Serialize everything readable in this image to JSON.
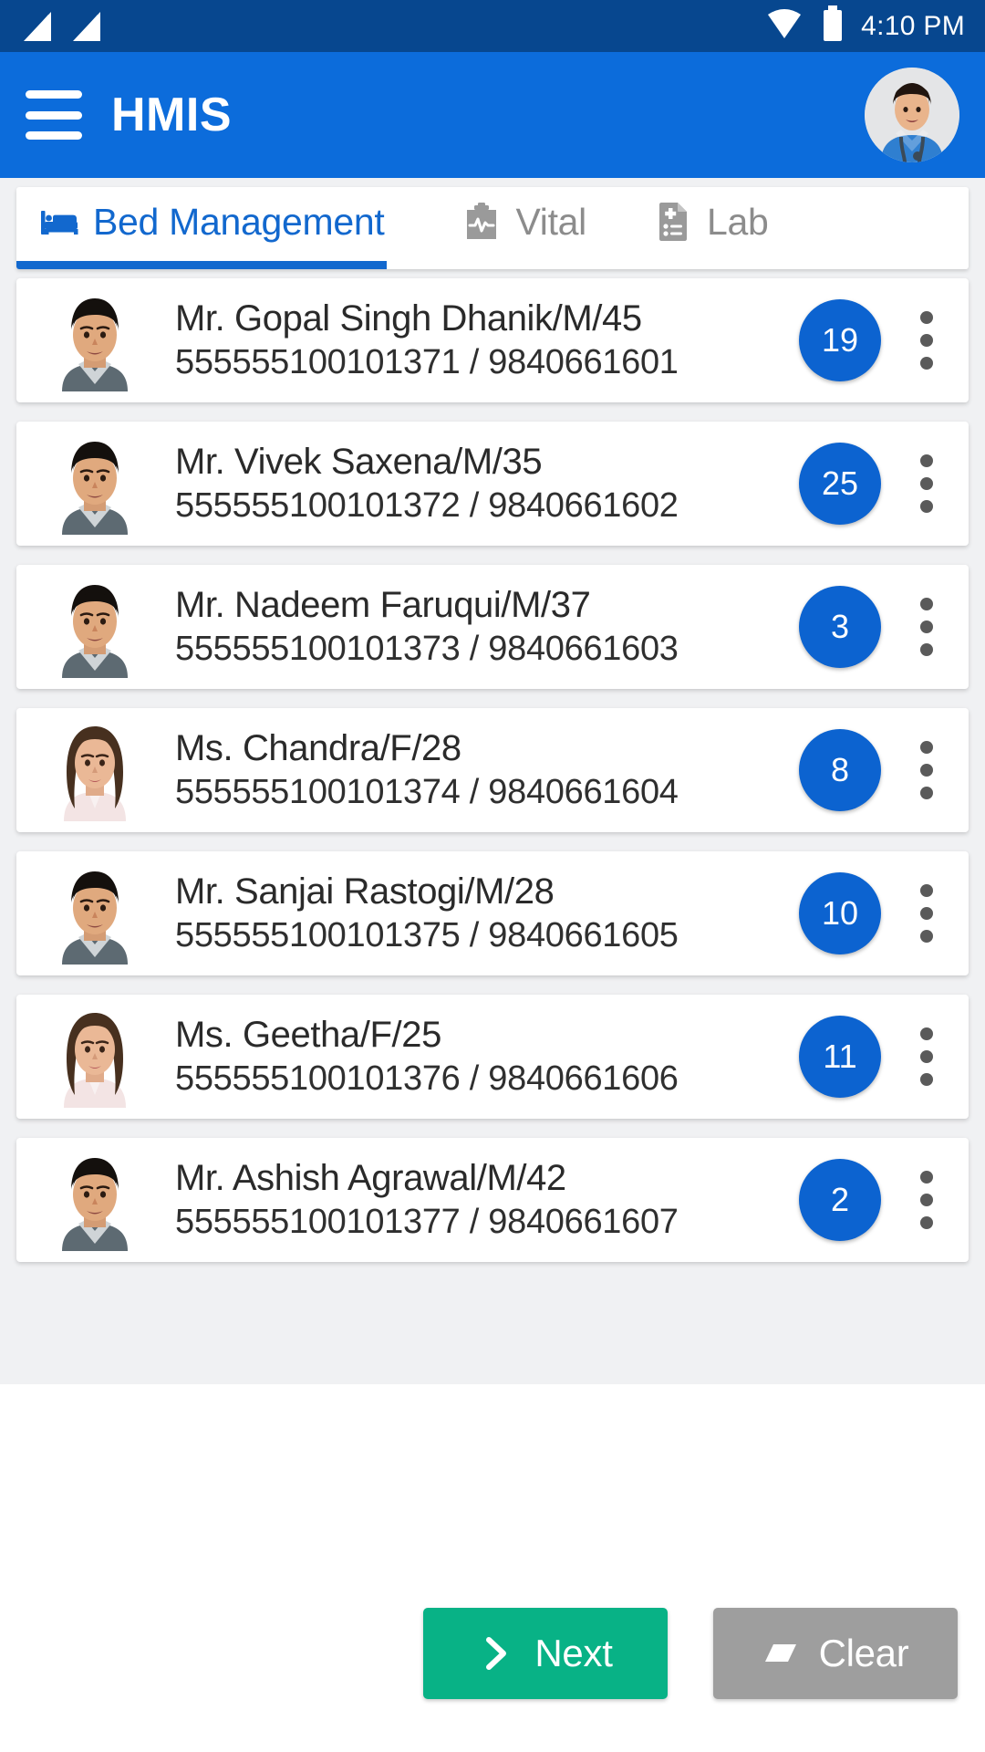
{
  "status_bar": {
    "time": "4:10 PM",
    "icons": [
      "signal-icon",
      "signal-icon",
      "wifi-icon",
      "battery-icon"
    ],
    "background_color": "#07478F"
  },
  "app_bar": {
    "menu_icon": "hamburger-menu-icon",
    "title": "HMIS",
    "avatar_icon": "user-avatar-nurse",
    "background_color": "#0C6CDB"
  },
  "tabs": [
    {
      "id": "bed-management",
      "label": "Bed Management",
      "icon": "bed-icon",
      "active": true
    },
    {
      "id": "vital",
      "label": "Vital",
      "icon": "clipboard-pulse-icon",
      "active": false
    },
    {
      "id": "lab",
      "label": "Lab",
      "icon": "lab-report-icon",
      "active": false
    }
  ],
  "tab_colors": {
    "active": "#1268CE",
    "inactive": "#8C8C8C",
    "underline": "#1268CE"
  },
  "patients": [
    {
      "name": "Mr. Gopal Singh Dhanik/M/45",
      "meta": "555555100101371 / 9840661601",
      "bed": "19",
      "avatar": "male",
      "menu_icon": "more-vertical-icon"
    },
    {
      "name": "Mr. Vivek Saxena/M/35",
      "meta": "555555100101372 / 9840661602",
      "bed": "25",
      "avatar": "male",
      "menu_icon": "more-vertical-icon"
    },
    {
      "name": "Mr. Nadeem Faruqui/M/37",
      "meta": "555555100101373 / 9840661603",
      "bed": "3",
      "avatar": "male",
      "menu_icon": "more-vertical-icon"
    },
    {
      "name": "Ms. Chandra/F/28",
      "meta": "555555100101374 / 9840661604",
      "bed": "8",
      "avatar": "female",
      "menu_icon": "more-vertical-icon"
    },
    {
      "name": "Mr. Sanjai Rastogi/M/28",
      "meta": "555555100101375 / 9840661605",
      "bed": "10",
      "avatar": "male",
      "menu_icon": "more-vertical-icon"
    },
    {
      "name": "Ms. Geetha/F/25",
      "meta": "555555100101376 / 9840661606",
      "bed": "11",
      "avatar": "female",
      "menu_icon": "more-vertical-icon"
    },
    {
      "name": "Mr. Ashish Agrawal/M/42",
      "meta": "555555100101377 / 9840661607",
      "bed": "2",
      "avatar": "male",
      "menu_icon": "more-vertical-icon"
    }
  ],
  "badge_color": "#0C63D0",
  "footer": {
    "next_label": "Next",
    "next_icon": "chevron-right-icon",
    "next_color": "#08B286",
    "clear_label": "Clear",
    "clear_icon": "eraser-icon",
    "clear_color": "#9E9E9E"
  }
}
